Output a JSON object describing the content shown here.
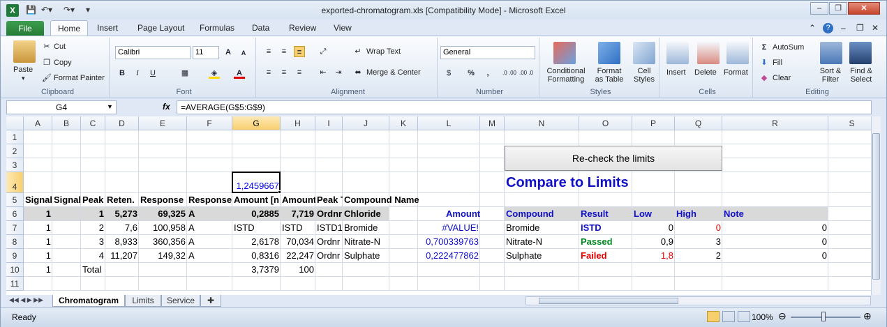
{
  "window": {
    "title": "exported-chromatogram.xls  [Compatibility Mode]  -  Microsoft Excel",
    "app_icon": "X"
  },
  "ribbon_tabs": [
    "File",
    "Home",
    "Insert",
    "Page Layout",
    "Formulas",
    "Data",
    "Review",
    "View"
  ],
  "active_tab": "Home",
  "clipboard": {
    "paste": "Paste",
    "cut": "Cut",
    "copy": "Copy",
    "format_painter": "Format Painter",
    "label": "Clipboard"
  },
  "font": {
    "name": "Calibri",
    "size": "11",
    "label": "Font",
    "bold": "B",
    "italic": "I",
    "underline": "U"
  },
  "alignment": {
    "wrap": "Wrap Text",
    "merge": "Merge & Center",
    "label": "Alignment"
  },
  "number": {
    "format": "General",
    "percent": "%",
    "comma": ",",
    "label": "Number",
    "inc_dec": ".0 .00",
    "dec_dec": ".00 .0"
  },
  "styles": {
    "conditional": "Conditional\nFormatting",
    "format_table": "Format\nas Table",
    "cell_styles": "Cell\nStyles",
    "label": "Styles"
  },
  "cells": {
    "insert": "Insert",
    "delete": "Delete",
    "format": "Format",
    "label": "Cells"
  },
  "editing": {
    "autosum": "AutoSum",
    "fill": "Fill",
    "clear": "Clear",
    "sort": "Sort &\nFilter",
    "find": "Find &\nSelect",
    "label": "Editing"
  },
  "formula_bar": {
    "name_box": "G4",
    "fx": "fx",
    "formula": "=AVERAGE(G$5:G$9)"
  },
  "columns": [
    "A",
    "B",
    "C",
    "D",
    "E",
    "F",
    "G",
    "H",
    "I",
    "J",
    "K",
    "L",
    "M",
    "N",
    "O",
    "P",
    "Q",
    "R",
    "S"
  ],
  "rows": [
    "1",
    "2",
    "3",
    "4",
    "5",
    "6",
    "7",
    "8",
    "9",
    "10",
    "11"
  ],
  "selected": {
    "col": "G",
    "row": "4"
  },
  "grid": {
    "g4": "1,2459667",
    "row5": [
      "Signal",
      "Signal",
      "Peak",
      "Reten.",
      "Response",
      "Response",
      "Amount [n",
      "Amount",
      "Peak T",
      "Compound Name"
    ],
    "row6": [
      "1",
      "",
      "1",
      "5,273",
      "69,325",
      "A",
      "0,2885",
      "7,719",
      "Ordnr",
      "Chloride"
    ],
    "row7": [
      "1",
      "",
      "2",
      "7,6",
      "100,958",
      "A",
      "ISTD",
      "ISTD",
      "ISTD1",
      "Bromide"
    ],
    "row8": [
      "1",
      "",
      "3",
      "8,933",
      "360,356",
      "A",
      "2,6178",
      "70,034",
      "Ordnr",
      "Nitrate-N"
    ],
    "row9": [
      "1",
      "",
      "4",
      "11,207",
      "149,32",
      "A",
      "0,8316",
      "22,247",
      "Ordnr",
      "Sulphate"
    ],
    "row10": [
      "1",
      "",
      "Total",
      "",
      "",
      "",
      "3,7379",
      "100",
      "",
      ""
    ],
    "amount_pct_header": "Amount %",
    "amount_pct": [
      "#VALUE!",
      "0,700339763",
      "0,222477862"
    ]
  },
  "limits": {
    "button": "Re-check the limits",
    "title": "Compare to Limits",
    "headers": [
      "Compound",
      "Result",
      "Low",
      "High",
      "Note"
    ],
    "rows": [
      {
        "compound": "Bromide",
        "result": "ISTD",
        "low": "0",
        "high": "0",
        "note": "0"
      },
      {
        "compound": "Nitrate-N",
        "result": "Passed",
        "low": "0,9",
        "high": "3",
        "note": "0"
      },
      {
        "compound": "Sulphate",
        "result": "Failed",
        "low": "1,8",
        "high": "2",
        "note": "0"
      }
    ]
  },
  "sheets": [
    "Chromatogram",
    "Limits",
    "Service"
  ],
  "active_sheet": "Chromatogram",
  "status": {
    "ready": "Ready",
    "zoom": "100%"
  },
  "colors": {
    "accent_green": "#247a34",
    "selection": "#f8cf6d",
    "link_blue": "#0000ee",
    "fail_red": "#e00000",
    "pass_green": "#00881e"
  }
}
